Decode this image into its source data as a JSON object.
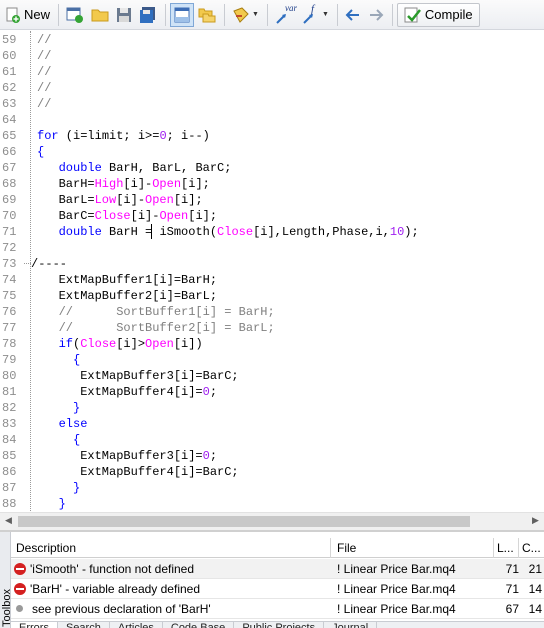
{
  "toolbar": {
    "new_label": "New",
    "compile_label": "Compile",
    "var_label": "var",
    "f_label": "f"
  },
  "code_lines": [
    {
      "n": "59",
      "text": "//"
    },
    {
      "n": "60",
      "text": "//"
    },
    {
      "n": "61",
      "text": "//"
    },
    {
      "n": "62",
      "text": "//"
    },
    {
      "n": "63",
      "text": "//"
    },
    {
      "n": "64",
      "text": ""
    },
    {
      "n": "65",
      "text": "for (i=limit; i>=0; i--)"
    },
    {
      "n": "66",
      "text": "{"
    },
    {
      "n": "67",
      "text": "   double BarH, BarL, BarC;"
    },
    {
      "n": "68",
      "text": "   BarH=High[i]-Open[i];"
    },
    {
      "n": "69",
      "text": "   BarL=Low[i]-Open[i];"
    },
    {
      "n": "70",
      "text": "   BarC=Close[i]-Open[i];"
    },
    {
      "n": "71",
      "text": "   double BarH = iSmooth(Close[i],Length,Phase,i,10);"
    },
    {
      "n": "72",
      "text": ""
    },
    {
      "n": "73",
      "text": "/----"
    },
    {
      "n": "74",
      "text": "   ExtMapBuffer1[i]=BarH;"
    },
    {
      "n": "75",
      "text": "   ExtMapBuffer2[i]=BarL;"
    },
    {
      "n": "76",
      "text": "   //      SortBuffer1[i] = BarH;"
    },
    {
      "n": "77",
      "text": "   //      SortBuffer2[i] = BarL;"
    },
    {
      "n": "78",
      "text": "   if(Close[i]>Open[i])"
    },
    {
      "n": "79",
      "text": "     {"
    },
    {
      "n": "80",
      "text": "      ExtMapBuffer3[i]=BarC;"
    },
    {
      "n": "81",
      "text": "      ExtMapBuffer4[i]=0;"
    },
    {
      "n": "82",
      "text": "     }"
    },
    {
      "n": "83",
      "text": "   else"
    },
    {
      "n": "84",
      "text": "     {"
    },
    {
      "n": "85",
      "text": "      ExtMapBuffer3[i]=0;"
    },
    {
      "n": "86",
      "text": "      ExtMapBuffer4[i]=BarC;"
    },
    {
      "n": "87",
      "text": "     }"
    },
    {
      "n": "88",
      "text": "   }"
    }
  ],
  "errors": {
    "headers": {
      "description": "Description",
      "file": "File",
      "line": "L...",
      "col": "C..."
    },
    "rows": [
      {
        "description": "'iSmooth' - function not defined",
        "file": "! Linear Price Bar.mq4",
        "line": "71",
        "col": "21",
        "severity": "error"
      },
      {
        "description": "'BarH' - variable already defined",
        "file": "! Linear Price Bar.mq4",
        "line": "71",
        "col": "14",
        "severity": "error"
      },
      {
        "description": "see previous declaration of 'BarH'",
        "file": "! Linear Price Bar.mq4",
        "line": "67",
        "col": "14",
        "severity": "info"
      }
    ]
  },
  "panel_tabs": [
    "Errors",
    "Search",
    "Articles",
    "Code Base",
    "Public Projects",
    "Journal"
  ],
  "toolbox_label": "Toolbox",
  "colors": {
    "keyword": "#0000ff",
    "series": "#ff00ff",
    "number": "#a020f0",
    "comment": "#808080",
    "error": "#d42020"
  }
}
